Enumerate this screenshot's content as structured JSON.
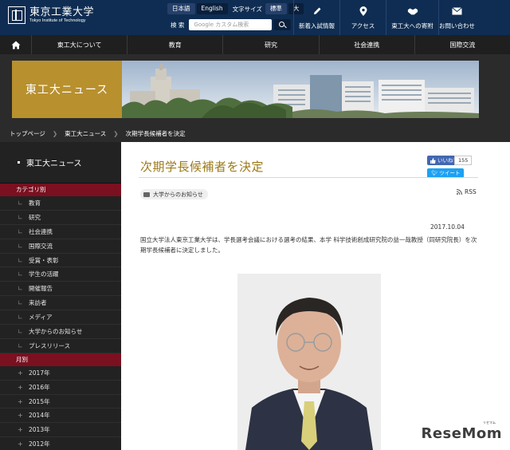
{
  "header": {
    "logo_jp": "東京工業大学",
    "logo_en": "Tokyo Institute of Technology",
    "lang_label_ja": "日本語",
    "lang_label_en": "English",
    "textsize_label": "文字サイズ",
    "size_standard": "標準",
    "size_large": "大",
    "search_label": "検 索",
    "search_placeholder": "Google カスタム検索",
    "quick_links": [
      {
        "label": "新着入試情報",
        "icon": "pencil-icon"
      },
      {
        "label": "アクセス",
        "icon": "map-pin-icon"
      },
      {
        "label": "東工大への寄附",
        "icon": "handshake-icon"
      },
      {
        "label": "お問い合わせ",
        "icon": "envelope-icon"
      }
    ]
  },
  "nav": {
    "items": [
      "東工大について",
      "教育",
      "研究",
      "社会連携",
      "国際交流"
    ]
  },
  "banner": {
    "title": "東工大ニュース"
  },
  "breadcrumb": [
    "トップページ",
    "東工大ニュース",
    "次期学長候補者を決定"
  ],
  "sidebar": {
    "heading": "東工大ニュース",
    "category_label": "カテゴリ別",
    "categories": [
      "教育",
      "研究",
      "社会連携",
      "国際交流",
      "受賞・表彰",
      "学生の活躍",
      "開催報告",
      "来訪者",
      "メディア",
      "大学からのお知らせ",
      "プレスリリース"
    ],
    "monthly_label": "月別",
    "years": [
      "2017年",
      "2016年",
      "2015年",
      "2014年",
      "2013年",
      "2012年"
    ]
  },
  "article": {
    "title": "次期学長候補者を決定",
    "fb_label": "いいね！",
    "fb_count": "155",
    "tweet_label": "ツイート",
    "tag": "大学からのお知らせ",
    "rss_label": "RSS",
    "date": "2017.10.04",
    "body": "国立大学法人東京工業大学は、学長選考会議における選考の結果、本学 科学技術創成研究院の益一哉教授（同研究院長）を次期学長候補者に決定しました。"
  },
  "watermark": {
    "text": "ReseMom",
    "small": "リセマム"
  }
}
